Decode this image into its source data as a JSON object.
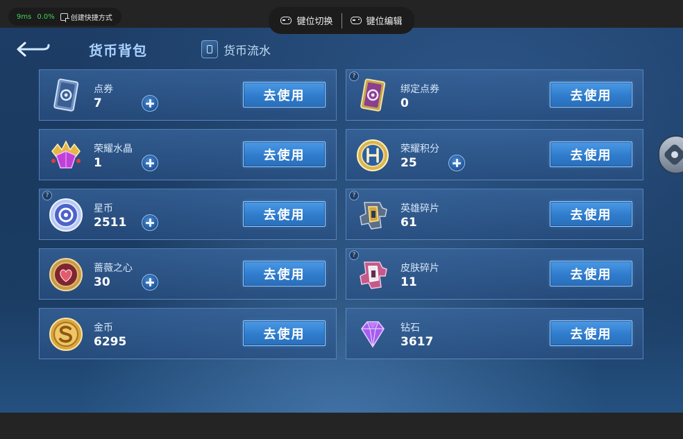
{
  "overlay": {
    "latency": "9ms",
    "cpu": "0.0%",
    "shortcut_label": "创建快捷方式",
    "key_switch": "键位切换",
    "key_edit": "键位编辑"
  },
  "header": {
    "title": "货币背包",
    "flow_tab": "货币流水"
  },
  "currencies": [
    {
      "name": "点券",
      "value": "7",
      "button": "去使用",
      "icon": "coupon-card-icon",
      "plus": true,
      "help": false
    },
    {
      "name": "绑定点券",
      "value": "0",
      "button": "去使用",
      "icon": "bound-coupon-card-icon",
      "plus": false,
      "help": true
    },
    {
      "name": "荣耀水晶",
      "value": "1",
      "button": "去使用",
      "icon": "glory-crystal-icon",
      "plus": true,
      "help": false
    },
    {
      "name": "荣耀积分",
      "value": "25",
      "button": "去使用",
      "icon": "glory-points-icon",
      "plus": true,
      "help": false
    },
    {
      "name": "星币",
      "value": "2511",
      "button": "去使用",
      "icon": "star-coin-icon",
      "plus": true,
      "help": true
    },
    {
      "name": "英雄碎片",
      "value": "61",
      "button": "去使用",
      "icon": "hero-fragment-icon",
      "plus": false,
      "help": true
    },
    {
      "name": "蔷薇之心",
      "value": "30",
      "button": "去使用",
      "icon": "rose-heart-icon",
      "plus": true,
      "help": false
    },
    {
      "name": "皮肤碎片",
      "value": "11",
      "button": "去使用",
      "icon": "skin-fragment-icon",
      "plus": false,
      "help": true
    },
    {
      "name": "金币",
      "value": "6295",
      "button": "去使用",
      "icon": "gold-coin-icon",
      "plus": false,
      "help": false
    },
    {
      "name": "钻石",
      "value": "3617",
      "button": "去使用",
      "icon": "diamond-icon",
      "plus": false,
      "help": false
    }
  ],
  "colors": {
    "accent": "#4b9ae6",
    "title": "#a9d2ff",
    "background": "#1d3d66"
  }
}
